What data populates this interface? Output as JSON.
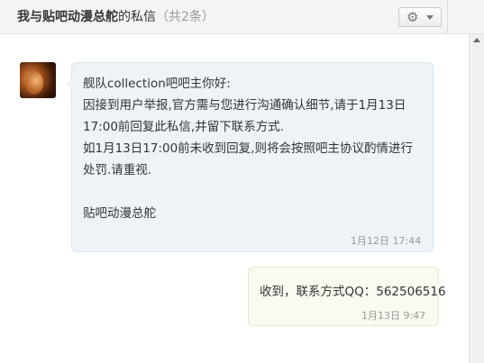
{
  "header": {
    "title_name": "我与贴吧动漫总舵",
    "title_suffix": "的私信",
    "title_count": "（共2条）"
  },
  "icons": {
    "settings": "gear-icon",
    "dropdown": "caret-down-icon",
    "avatar": "user-avatar"
  },
  "messages": [
    {
      "direction": "received",
      "lines": [
        "舰队collection吧吧主你好:",
        "因接到用户举报,官方需与您进行沟通确认细节,请于1月13日",
        "17:00前回复此私信,并留下联系方式.",
        "如1月13日17:00前未收到回复,则将会按照吧主协议酌情进行",
        "处罚.请重视.",
        "",
        "贴吧动漫总舵"
      ],
      "time": "1月12日 17:44"
    },
    {
      "direction": "sent",
      "text": "收到，联系方式QQ：562506516",
      "time": "1月13日 9:47"
    }
  ],
  "colors": {
    "received_bubble_bg": "#eef3f8",
    "sent_bubble_bg": "#fbfaf0",
    "header_bg": "#f4f4f4"
  }
}
